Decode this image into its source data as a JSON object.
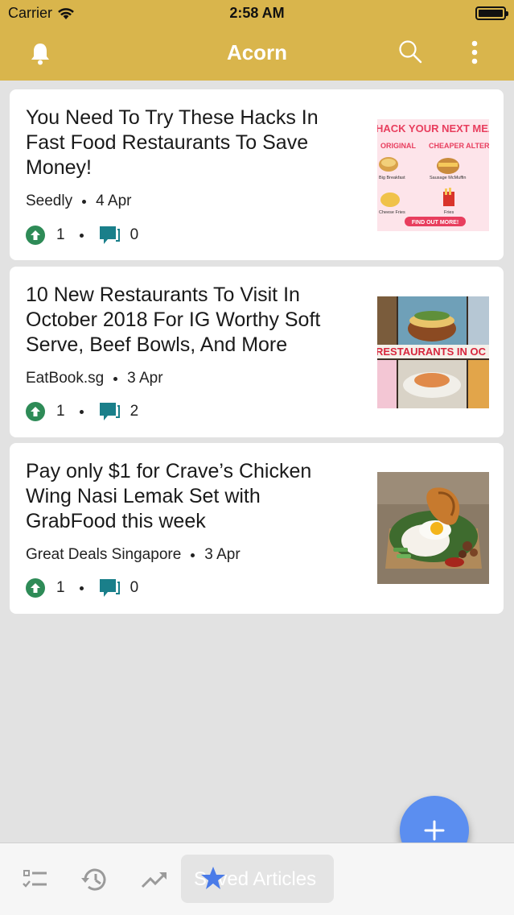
{
  "status_bar": {
    "carrier": "Carrier",
    "time": "2:58 AM"
  },
  "app_bar": {
    "title": "Acorn",
    "icons": [
      "bell-icon",
      "search-icon",
      "more-vertical-icon"
    ]
  },
  "articles": [
    {
      "title": "You Need To Try These Hacks In Fast Food Restaurants To Save Money!",
      "source": "Seedly",
      "date": "4 Apr",
      "upvotes": "1",
      "comments": "0",
      "thumbnail_text": [
        "HACK YOUR NEXT MEAL",
        "ORIGINAL",
        "CHEAPER ALTERNATIVE",
        "Big Breakfast",
        "Sausage McMuffin",
        "Cheese Fries",
        "Fries",
        "FIND OUT MORE!"
      ]
    },
    {
      "title": "10 New Restaurants To Visit In October 2018 For IG Worthy Soft Serve, Beef Bowls, And More",
      "source": "EatBook.sg",
      "date": "3 Apr",
      "upvotes": "1",
      "comments": "2",
      "thumbnail_text": [
        "RESTAURANTS IN OC"
      ]
    },
    {
      "title": "Pay only $1 for Crave’s Chicken Wing Nasi Lemak Set with GrabFood this week",
      "source": "Great Deals Singapore",
      "date": "3 Apr",
      "upvotes": "1",
      "comments": "0"
    }
  ],
  "fab": {
    "icon": "plus-icon"
  },
  "tab_bar": {
    "tabs": [
      {
        "icon": "checklist-icon"
      },
      {
        "icon": "history-icon"
      },
      {
        "icon": "trending-icon"
      },
      {
        "icon": "star-icon",
        "label": "Saved Articles",
        "active": true
      }
    ]
  },
  "colors": {
    "header": "#d9b54c",
    "upvote": "#2e8b57",
    "comment": "#1a7f8a",
    "fab": "#5b8ef0",
    "active_star": "#4a7be8"
  }
}
